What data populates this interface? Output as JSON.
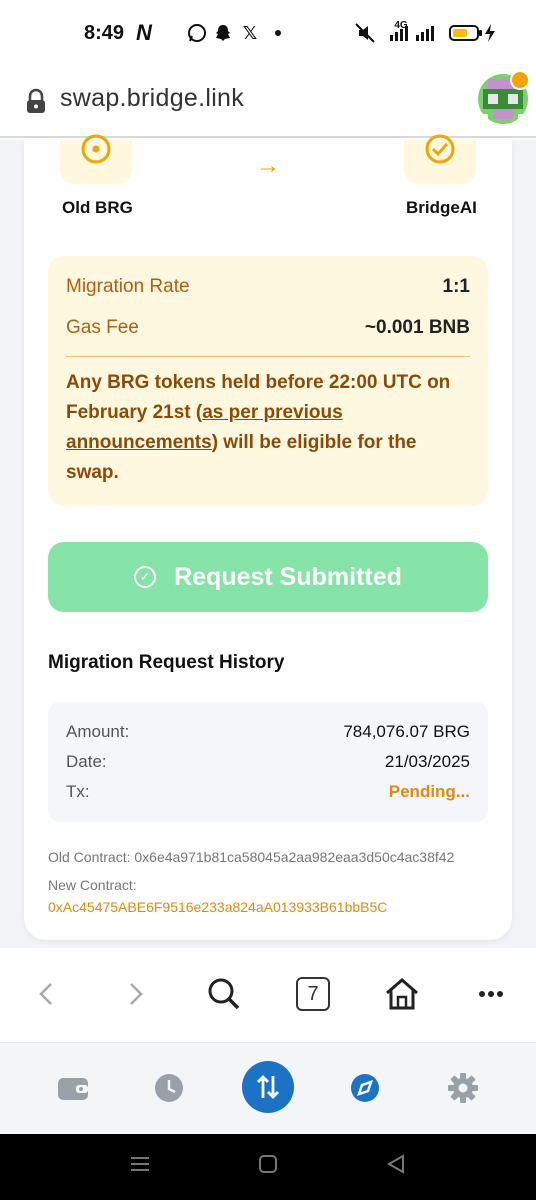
{
  "status_bar": {
    "time": "8:49",
    "network_label": "4G",
    "icons": [
      "netflix-icon",
      "whatsapp-icon",
      "snapchat-icon",
      "x-icon",
      "dot-icon",
      "mute-icon",
      "signal-icon",
      "battery-icon",
      "charging-icon"
    ]
  },
  "url_bar": {
    "url": "swap.bridge.link"
  },
  "swap": {
    "from_token": "Old BRG",
    "to_token": "BridgeAI",
    "arrow": "→"
  },
  "info": {
    "rate_label": "Migration Rate",
    "rate_value": "1:1",
    "gas_label": "Gas Fee",
    "gas_value": "~0.001 BNB",
    "notice_before": "Any BRG tokens held before 22:00 UTC on February 21st (",
    "notice_link": "as per previous announcements",
    "notice_after": ") will be eligible for the swap."
  },
  "submit_button": {
    "label": "Request Submitted"
  },
  "history": {
    "title": "Migration Request History",
    "amount_label": "Amount:",
    "amount_value": "784,076.07 BRG",
    "date_label": "Date:",
    "date_value": "21/03/2025",
    "tx_label": "Tx:",
    "tx_value": "Pending..."
  },
  "contracts": {
    "old_label": "Old Contract: 0x6e4a971b81ca58045a2aa982eaa3d50c4ac38f42",
    "new_label": "New Contract:",
    "new_address": "0xAc45475ABE6F9516e233a824aA013933B61bbB5C"
  },
  "browser_nav": {
    "tab_count": "7"
  },
  "colors": {
    "accent_orange": "#f0a500",
    "pending_orange": "#e08a12",
    "button_green": "#86e3a8",
    "wallet_blue": "#1a73c7"
  }
}
